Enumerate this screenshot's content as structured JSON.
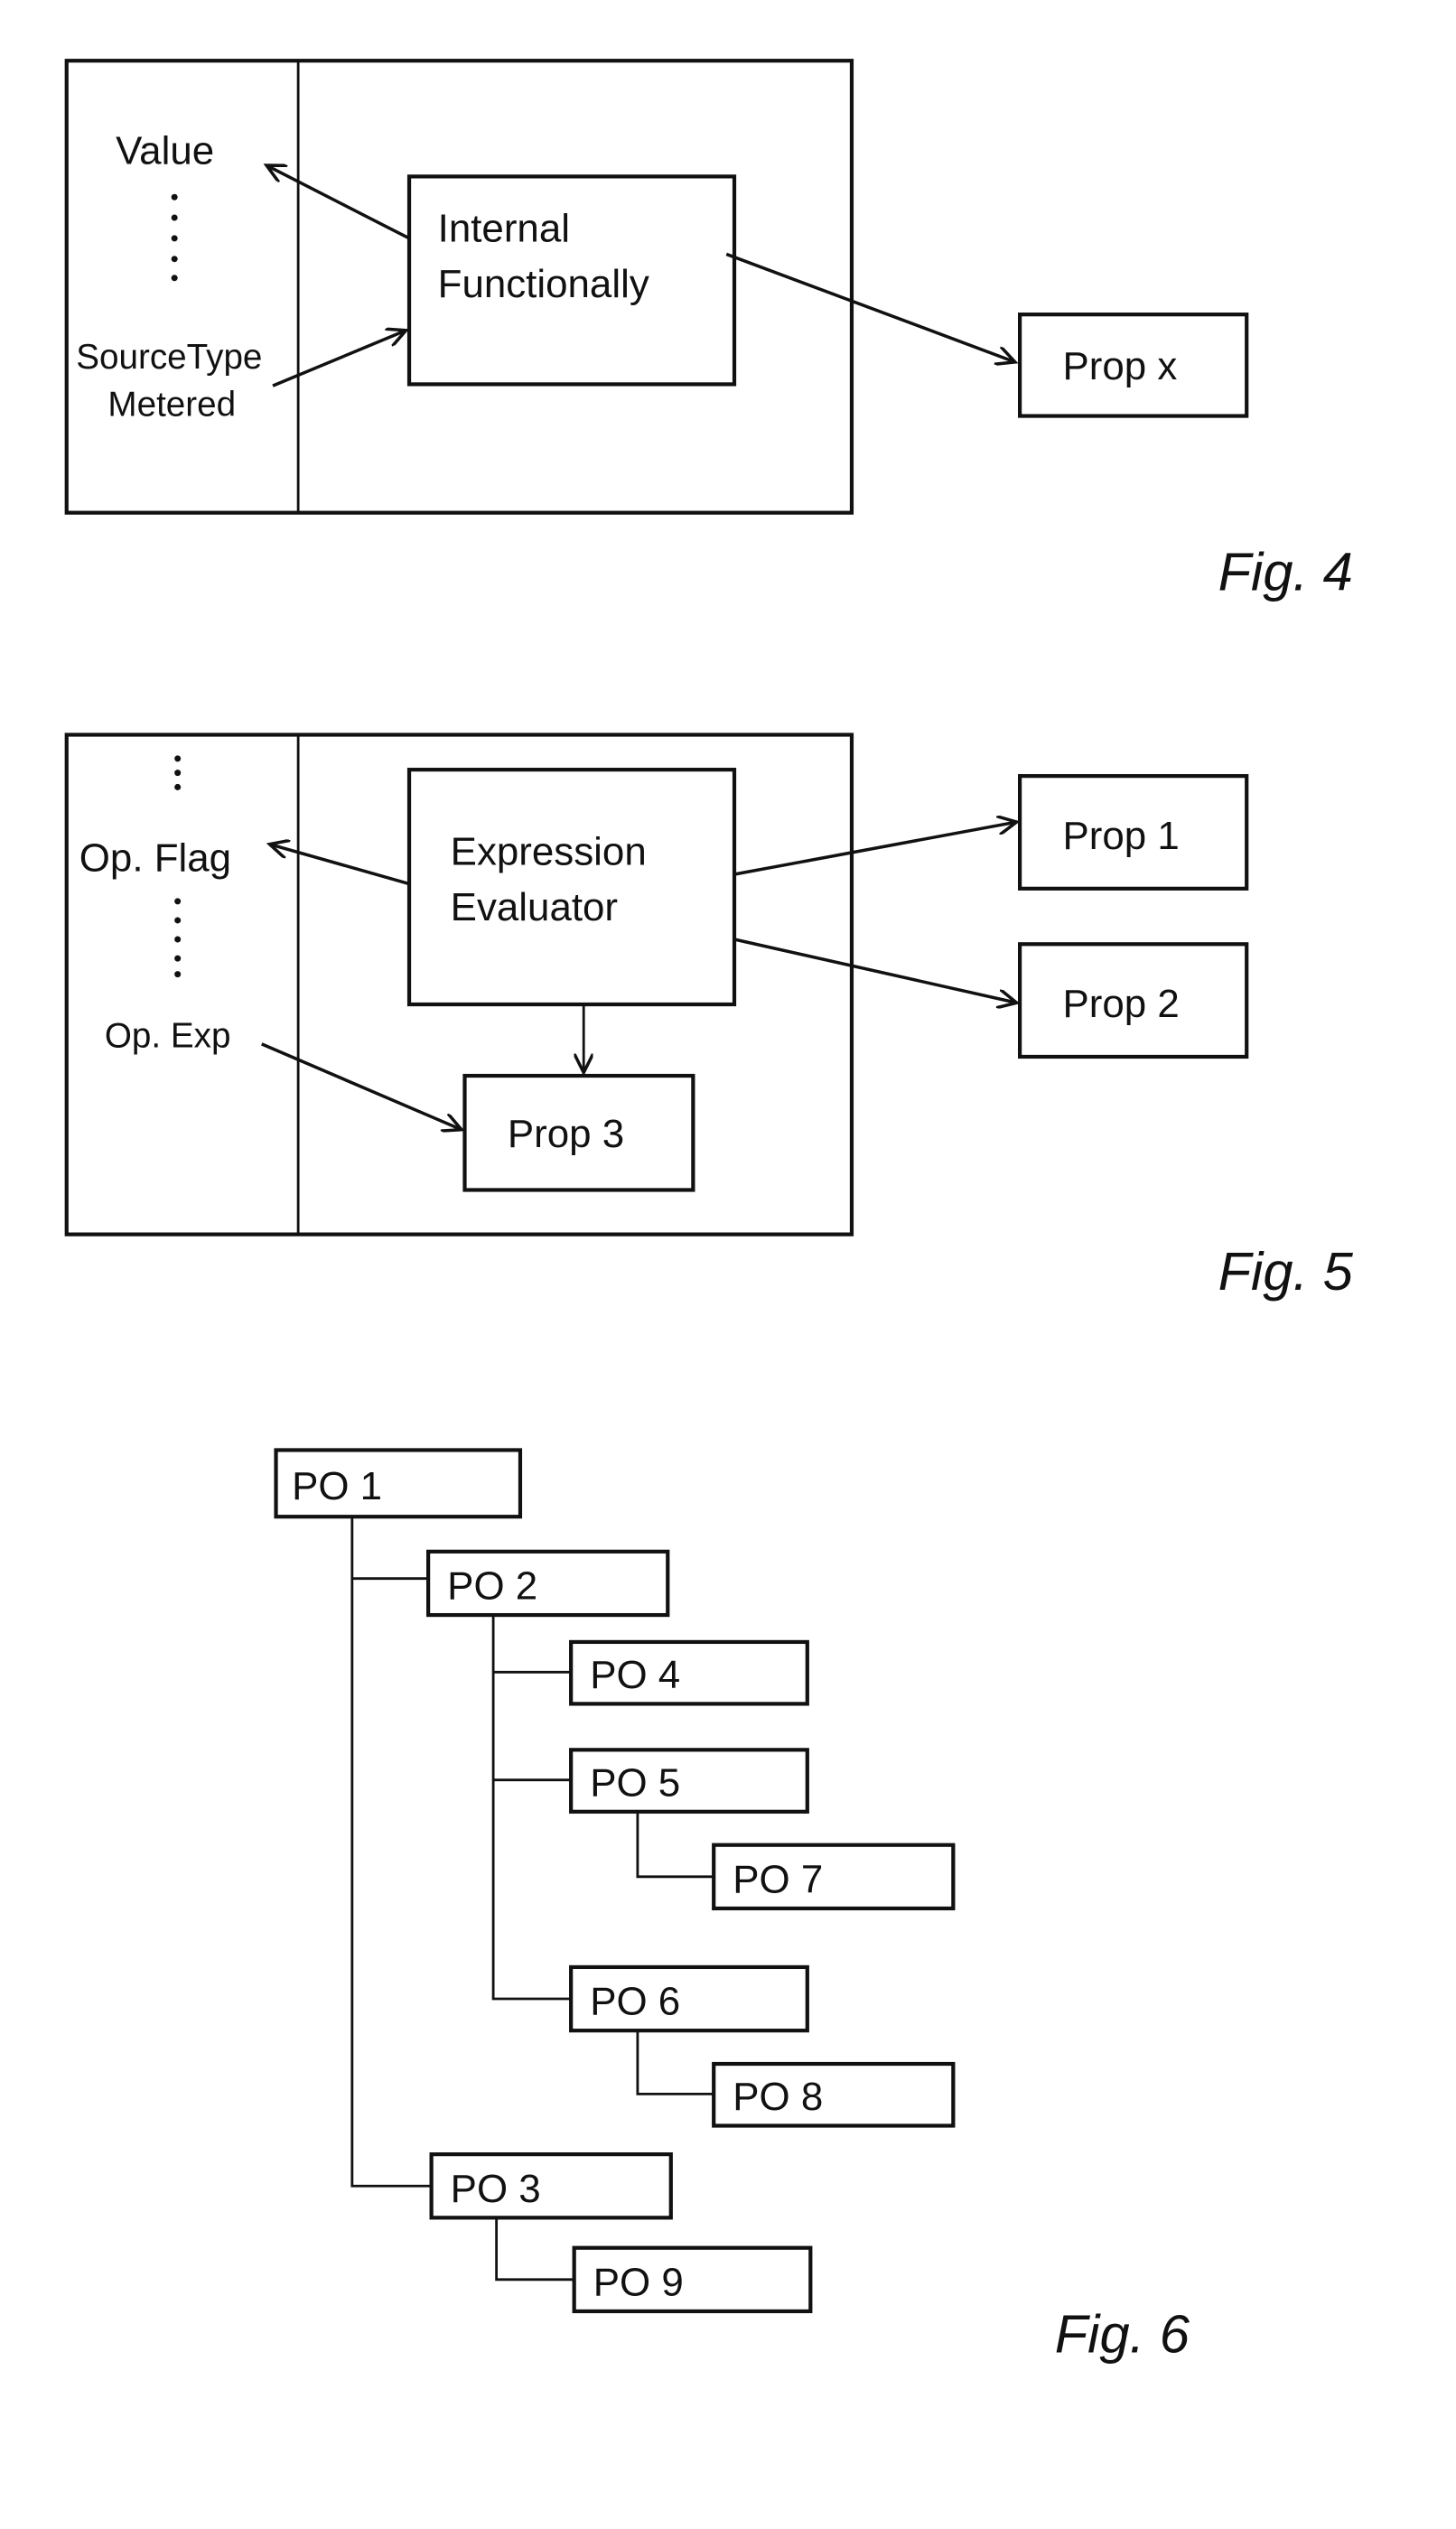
{
  "figures": {
    "fig4": {
      "caption": "Fig. 4",
      "left_column": {
        "top_label": "Value",
        "bottom_label_line1": "SourceType",
        "bottom_label_line2": "Metered"
      },
      "center_box": {
        "line1": "Internal",
        "line2": "Functionally"
      },
      "output_box": "Prop x"
    },
    "fig5": {
      "caption": "Fig. 5",
      "left_column": {
        "flag_label": "Op. Flag",
        "exp_label": "Op. Exp"
      },
      "center_box": {
        "line1": "Expression",
        "line2": "Evaluator"
      },
      "inner_box": "Prop 3",
      "outputs": [
        "Prop 1",
        "Prop 2"
      ]
    },
    "fig6": {
      "caption": "Fig. 6",
      "nodes": [
        "PO 1",
        "PO 2",
        "PO 4",
        "PO 5",
        "PO 7",
        "PO 6",
        "PO 8",
        "PO 3",
        "PO 9"
      ]
    }
  }
}
